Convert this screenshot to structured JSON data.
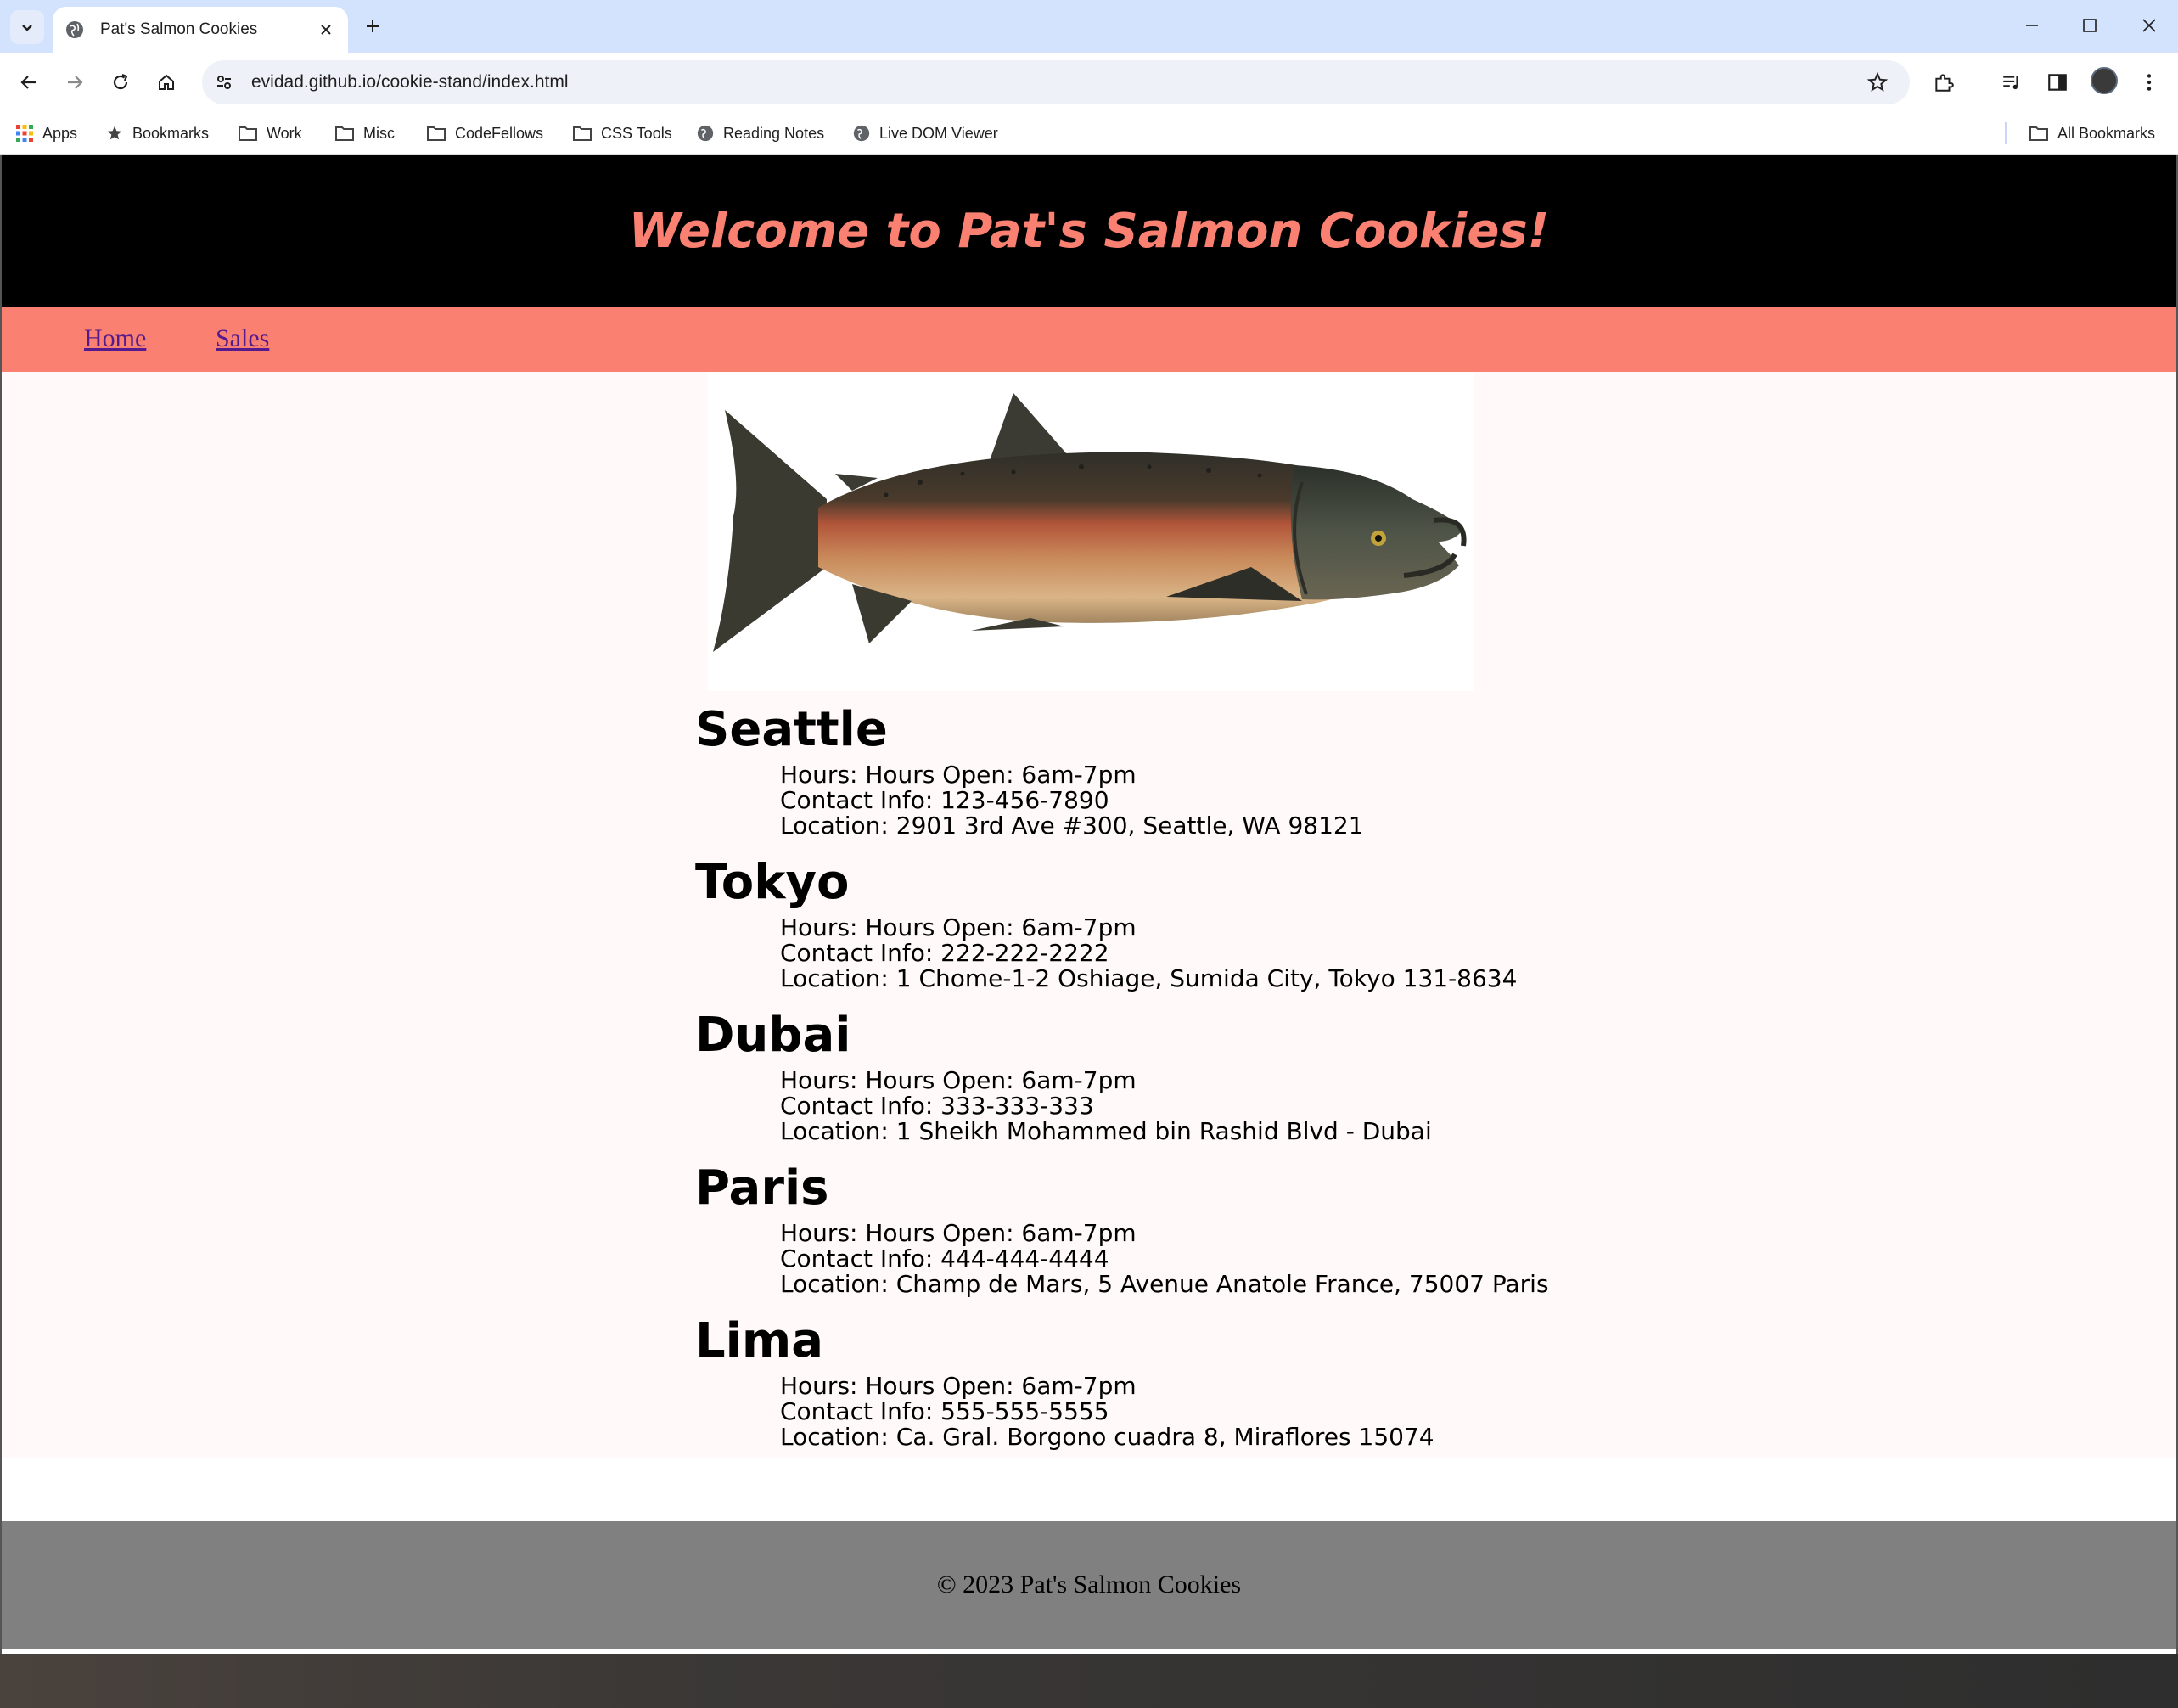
{
  "browser": {
    "tab_title": "Pat's Salmon Cookies",
    "url": "evidad.github.io/cookie-stand/index.html",
    "bookmarks": [
      {
        "label": "Apps",
        "icon": "apps-grid-icon"
      },
      {
        "label": "Bookmarks",
        "icon": "star-icon"
      },
      {
        "label": "Work",
        "icon": "folder-icon"
      },
      {
        "label": "Misc",
        "icon": "folder-icon"
      },
      {
        "label": "CodeFellows",
        "icon": "folder-icon"
      },
      {
        "label": "CSS Tools",
        "icon": "folder-icon"
      },
      {
        "label": "Reading Notes",
        "icon": "globe-icon"
      },
      {
        "label": "Live DOM Viewer",
        "icon": "globe-icon"
      }
    ],
    "all_bookmarks": "All Bookmarks"
  },
  "site": {
    "title": "Welcome to Pat's Salmon Cookies!",
    "nav": {
      "home": "Home",
      "sales": "Sales"
    },
    "hero_image_alt": "salmon",
    "footer": "© 2023 Pat's Salmon Cookies"
  },
  "stores": [
    {
      "name": "Seattle",
      "hours": "Hours: Hours Open: 6am-7pm",
      "contact": "Contact Info: 123-456-7890",
      "location": "Location: 2901 3rd Ave #300, Seattle, WA 98121"
    },
    {
      "name": "Tokyo",
      "hours": "Hours: Hours Open: 6am-7pm",
      "contact": "Contact Info: 222-222-2222",
      "location": "Location: 1 Chome-1-2 Oshiage, Sumida City, Tokyo 131-8634"
    },
    {
      "name": "Dubai",
      "hours": "Hours: Hours Open: 6am-7pm",
      "contact": "Contact Info: 333-333-333",
      "location": "Location: 1 Sheikh Mohammed bin Rashid Blvd - Dubai"
    },
    {
      "name": "Paris",
      "hours": "Hours: Hours Open: 6am-7pm",
      "contact": "Contact Info: 444-444-4444",
      "location": "Location: Champ de Mars, 5 Avenue Anatole France, 75007 Paris"
    },
    {
      "name": "Lima",
      "hours": "Hours: Hours Open: 6am-7pm",
      "contact": "Contact Info: 555-555-5555",
      "location": "Location: Ca. Gral. Borgono cuadra 8, Miraflores 15074"
    }
  ],
  "colors": {
    "header_bg": "#000000",
    "accent": "#fa8072",
    "content_bg": "#fffaf9",
    "footer_bg": "#808080",
    "link": "#551a8b"
  }
}
